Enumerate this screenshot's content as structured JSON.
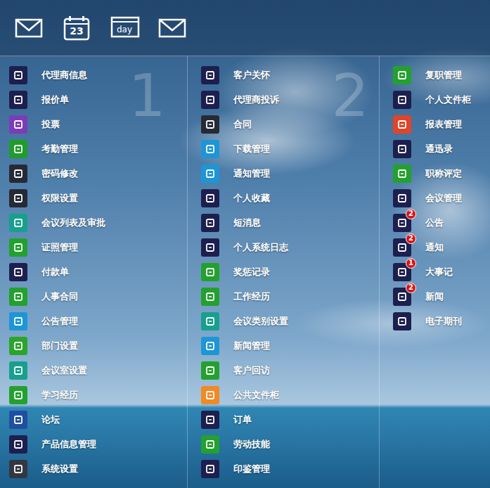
{
  "top_bar": {
    "calendar_day": "23",
    "day_label": "day"
  },
  "columns": [
    {
      "number": "1",
      "items": [
        {
          "label": "代理商信息",
          "color": "#1d1f4f"
        },
        {
          "label": "报价单",
          "color": "#1d1f4f"
        },
        {
          "label": "投票",
          "color": "#7b3cb8"
        },
        {
          "label": "考勤管理",
          "color": "#1f9d2b"
        },
        {
          "label": "密码修改",
          "color": "#262a35"
        },
        {
          "label": "权限设置",
          "color": "#262a35"
        },
        {
          "label": "会议列表及审批",
          "color": "#16a08d"
        },
        {
          "label": "证照管理",
          "color": "#23a12e"
        },
        {
          "label": "付款单",
          "color": "#1d1f4f"
        },
        {
          "label": "人事合同",
          "color": "#23a12e"
        },
        {
          "label": "公告管理",
          "color": "#1d96d6"
        },
        {
          "label": "部门设置",
          "color": "#2aa52a"
        },
        {
          "label": "会议室设置",
          "color": "#16a08d"
        },
        {
          "label": "学习经历",
          "color": "#23a12e"
        },
        {
          "label": "论坛",
          "color": "#1f4fa0"
        },
        {
          "label": "产品信息管理",
          "color": "#1d1f4f"
        },
        {
          "label": "系统设置",
          "color": "#333740"
        }
      ]
    },
    {
      "number": "2",
      "items": [
        {
          "label": "客户关怀",
          "color": "#1d1f4f"
        },
        {
          "label": "代理商投诉",
          "color": "#1d1f4f"
        },
        {
          "label": "合同",
          "color": "#262a35"
        },
        {
          "label": "下载管理",
          "color": "#1d96d6"
        },
        {
          "label": "通知管理",
          "color": "#1d96d6"
        },
        {
          "label": "个人收藏",
          "color": "#1d1f4f"
        },
        {
          "label": "短消息",
          "color": "#1d1f4f"
        },
        {
          "label": "个人系统日志",
          "color": "#1d1f4f"
        },
        {
          "label": "奖惩记录",
          "color": "#23a12e"
        },
        {
          "label": "工作经历",
          "color": "#23a12e"
        },
        {
          "label": "会议类别设置",
          "color": "#16a08d"
        },
        {
          "label": "新闻管理",
          "color": "#1d96d6"
        },
        {
          "label": "客户回访",
          "color": "#23a12e"
        },
        {
          "label": "公共文件柜",
          "color": "#f08a24"
        },
        {
          "label": "订单",
          "color": "#1d1f4f"
        },
        {
          "label": "劳动技能",
          "color": "#23a12e"
        },
        {
          "label": "印鉴管理",
          "color": "#1d1f4f"
        }
      ]
    },
    {
      "number": "",
      "items": [
        {
          "label": "复职管理",
          "color": "#23a12e"
        },
        {
          "label": "个人文件柜",
          "color": "#1d1f4f"
        },
        {
          "label": "报表管理",
          "color": "#e0452a"
        },
        {
          "label": "通迅录",
          "color": "#1d1f4f"
        },
        {
          "label": "职称评定",
          "color": "#23a12e"
        },
        {
          "label": "会议管理",
          "color": "#1d1f4f"
        },
        {
          "label": "公告",
          "color": "#1d1f4f",
          "badge": "2"
        },
        {
          "label": "通知",
          "color": "#1d1f4f",
          "badge": "2"
        },
        {
          "label": "大事记",
          "color": "#1d1f4f",
          "badge": "1"
        },
        {
          "label": "新闻",
          "color": "#1d1f4f",
          "badge": "2"
        },
        {
          "label": "电子期刊",
          "color": "#1d1f4f"
        }
      ]
    }
  ]
}
